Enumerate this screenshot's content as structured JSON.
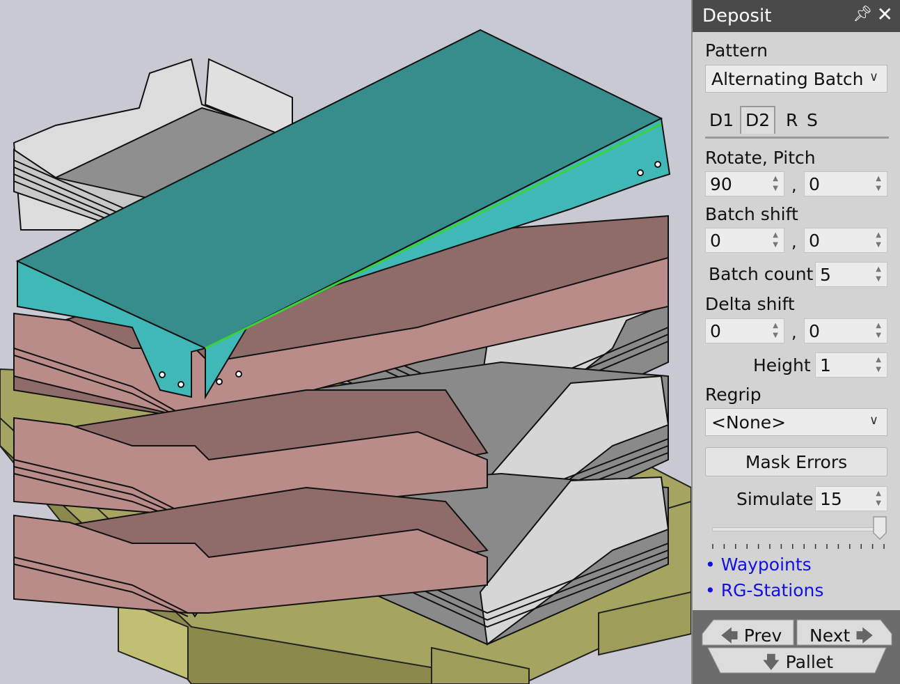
{
  "panel": {
    "title": "Deposit",
    "pin_icon": "pin-icon",
    "close_icon": "close-icon",
    "pattern_label": "Pattern",
    "pattern_value": "Alternating Batch",
    "tabs": [
      "D1",
      "D2",
      "R",
      "S"
    ],
    "active_tab": "D2",
    "rotate_pitch_label": "Rotate, Pitch",
    "rotate_value": "90",
    "pitch_value": "0",
    "batch_shift_label": "Batch shift",
    "batch_shift_x": "0",
    "batch_shift_y": "0",
    "batch_count_label": "Batch count",
    "batch_count_value": "5",
    "delta_shift_label": "Delta shift",
    "delta_shift_x": "0",
    "delta_shift_y": "0",
    "height_label": "Height",
    "height_value": "1",
    "regrip_label": "Regrip",
    "regrip_value": "<None>",
    "mask_errors_label": "Mask Errors",
    "simulate_label": "Simulate",
    "simulate_value": "15",
    "slider_level": 1.0,
    "links": [
      "• Waypoints",
      "• RG-Stations"
    ],
    "prev_label": "Prev",
    "next_label": "Next",
    "pallet_label": "Pallet",
    "comma": ","
  },
  "colors": {
    "titlebar": "#4a4a4a",
    "viewport_bg": "#c9c9d3",
    "pallet": "#a5a460",
    "teal_top": "#378d8c",
    "teal_side": "#41b8b8",
    "pink": "#b98c8a",
    "pink_top": "#8f6b6a",
    "gray_part": "#8a8a8a",
    "light_part": "#d8d8d8",
    "link": "#1010e8"
  }
}
